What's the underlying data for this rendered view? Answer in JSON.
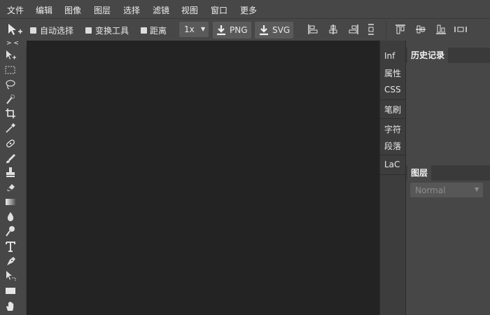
{
  "menu": {
    "items": [
      "文件",
      "编辑",
      "图像",
      "图层",
      "选择",
      "滤镜",
      "视图",
      "窗口",
      "更多"
    ]
  },
  "options": {
    "auto_select_label": "自动选择",
    "transform_tools_label": "变换工具",
    "distance_label": "距离",
    "zoom_value": "1x",
    "png_label": "PNG",
    "svg_label": "SVG"
  },
  "collapse": {
    "left_arrows": "> <",
    "mid_arrows": "< >"
  },
  "mini_panel": {
    "items": [
      "Inf",
      "属性",
      "CSS",
      "笔刷",
      "字符",
      "段落",
      "LaC"
    ]
  },
  "history_panel": {
    "title": "历史记录"
  },
  "layers_panel": {
    "title": "图层",
    "blend_mode": "Normal"
  },
  "colors": {
    "background": "#474747",
    "canvas": "#232323",
    "mini_panel": "#3d3d3d",
    "panel_header": "#3a3a3a"
  },
  "icons": [
    "move-tool-icon",
    "marquee-icon",
    "lasso-icon",
    "quick-select-icon",
    "crop-icon",
    "eyedropper-icon",
    "healing-icon",
    "brush-icon",
    "stamp-icon",
    "eraser-icon",
    "gradient-icon",
    "blur-icon",
    "dodge-icon",
    "type-icon",
    "pen-icon",
    "path-select-icon",
    "shape-icon",
    "hand-icon"
  ]
}
